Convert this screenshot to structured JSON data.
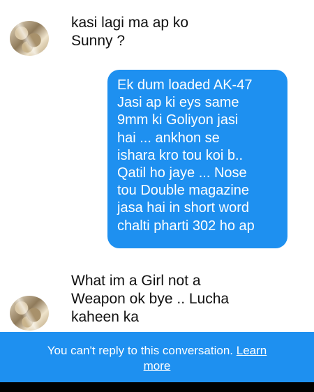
{
  "messages": [
    {
      "from": "them",
      "lines": [
        "kasi lagi ma ap ko",
        "Sunny ?"
      ]
    },
    {
      "from": "me",
      "lines": [
        "Ek dum loaded AK-47",
        "Jasi ap ki eys same",
        "9mm ki Goliyon jasi",
        "hai ... ankhon se",
        "ishara kro tou koi b..",
        "Qatil ho jaye ... Nose",
        "tou Double magazine",
        "jasa hai in short word",
        "chalti pharti 302 ho ap"
      ]
    },
    {
      "from": "them",
      "lines": [
        "What im a Girl not a",
        "Weapon ok bye .. Lucha",
        "kaheen ka"
      ]
    }
  ],
  "footer": {
    "notice": "You can't reply to this conversation.",
    "learn_more_line1": "Learn",
    "learn_more_line2": "more"
  },
  "colors": {
    "bubble": "#1e90f0",
    "footer": "#1e90f0"
  }
}
